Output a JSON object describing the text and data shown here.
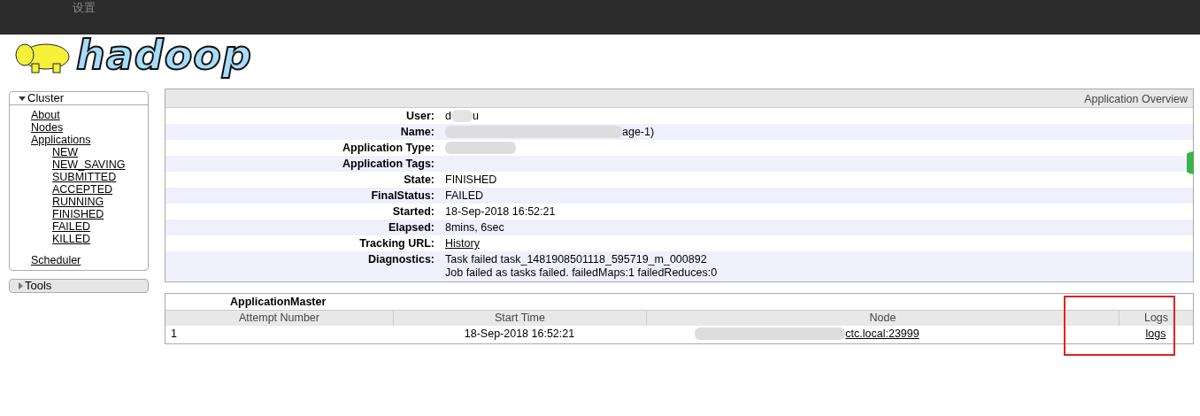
{
  "overlay_bar": {
    "text": "设置"
  },
  "logo": {
    "text": "hadoop"
  },
  "sidebar": {
    "sections": [
      {
        "label": "Cluster",
        "expanded": true,
        "children": [
          {
            "label": "About"
          },
          {
            "label": "Nodes"
          },
          {
            "label": "Applications",
            "children": [
              {
                "label": "NEW"
              },
              {
                "label": "NEW_SAVING"
              },
              {
                "label": "SUBMITTED"
              },
              {
                "label": "ACCEPTED"
              },
              {
                "label": "RUNNING"
              },
              {
                "label": "FINISHED"
              },
              {
                "label": "FAILED"
              },
              {
                "label": "KILLED"
              }
            ]
          },
          {
            "label": "Scheduler",
            "gap": true
          }
        ]
      },
      {
        "label": "Tools",
        "expanded": false
      }
    ]
  },
  "overview": {
    "title": "Application Overview",
    "rows": [
      {
        "label": "User:",
        "value": "d",
        "tail": "u",
        "kind": "blurred"
      },
      {
        "label": "Name:",
        "tail": "age-1)",
        "kind": "blurred_long"
      },
      {
        "label": "Application Type:",
        "kind": "blurred_short"
      },
      {
        "label": "Application Tags:",
        "kind": "empty"
      },
      {
        "label": "State:",
        "value": "FINISHED",
        "kind": "text"
      },
      {
        "label": "FinalStatus:",
        "value": "FAILED",
        "kind": "text"
      },
      {
        "label": "Started:",
        "value": "18-Sep-2018 16:52:21",
        "kind": "text"
      },
      {
        "label": "Elapsed:",
        "value": "8mins, 6sec",
        "kind": "text"
      },
      {
        "label": "Tracking URL:",
        "value": "History",
        "kind": "link"
      },
      {
        "label": "Diagnostics:",
        "lines": [
          "Task failed task_1481908501118_595719_m_000892",
          "Job failed as tasks failed. failedMaps:1 failedReduces:0"
        ],
        "kind": "lines"
      }
    ]
  },
  "attempts": {
    "title": "ApplicationMaster",
    "columns": [
      "Attempt Number",
      "Start Time",
      "Node",
      "Logs"
    ],
    "rows": [
      {
        "attempt": "1",
        "start_time": "18-Sep-2018 16:52:21",
        "node": "ctc.local:23999",
        "logs": "logs"
      }
    ]
  }
}
